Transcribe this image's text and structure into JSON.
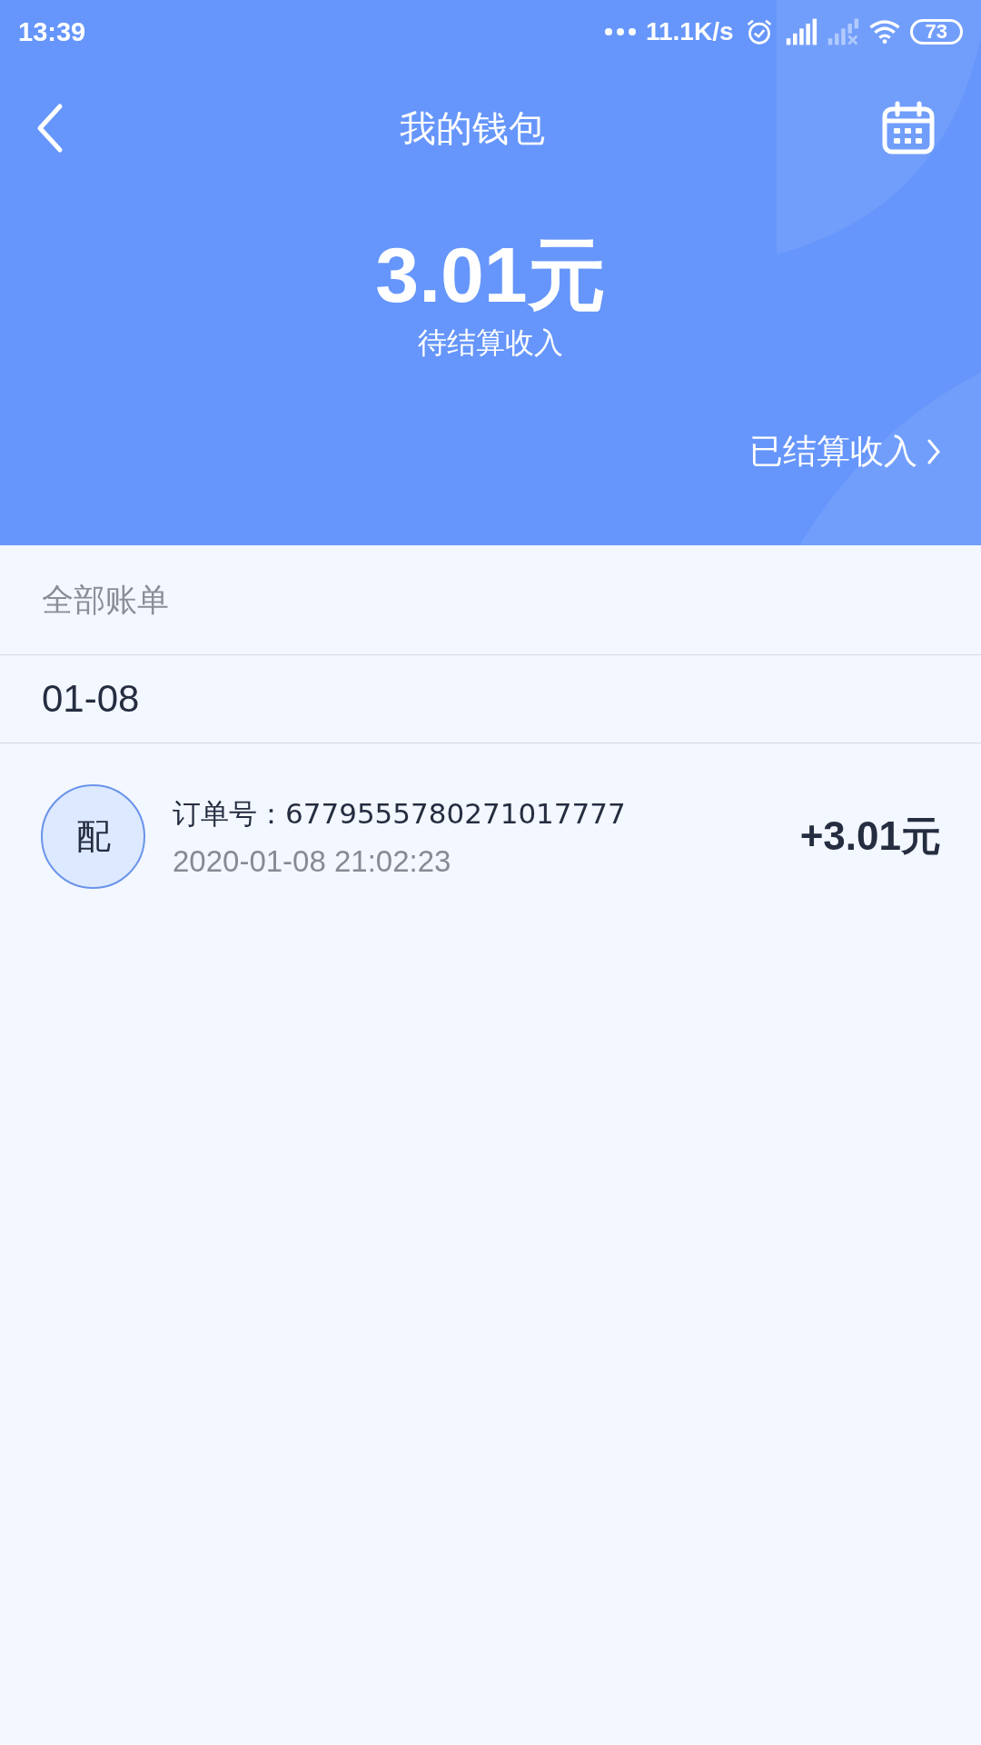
{
  "status_bar": {
    "time": "13:39",
    "network_speed": "11.1K/s",
    "battery": "73"
  },
  "header": {
    "title": "我的钱包",
    "amount": "3.01元",
    "amount_label": "待结算收入",
    "settled_link": "已结算收入"
  },
  "section_title": "全部账单",
  "groups": [
    {
      "date": "01-08",
      "records": [
        {
          "avatar": "配",
          "order": "订单号：6779555780271017777",
          "time": "2020-01-08 21:02:23",
          "amount": "+3.01元"
        }
      ]
    }
  ]
}
